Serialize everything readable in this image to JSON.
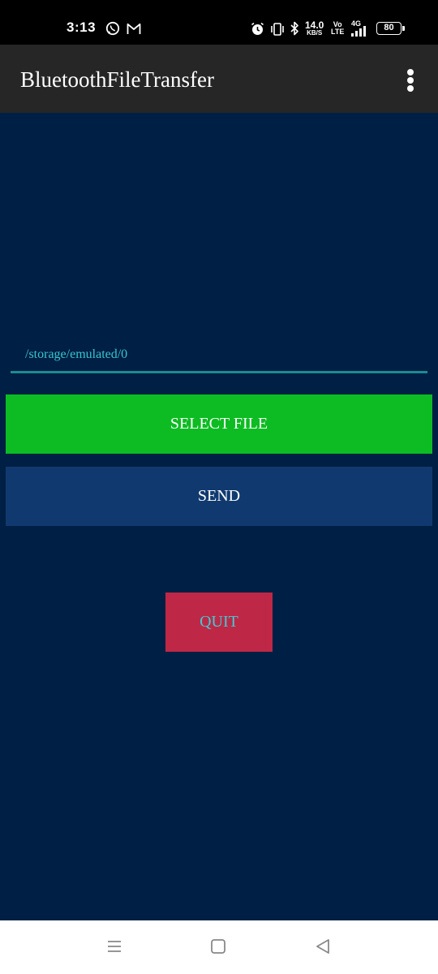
{
  "status_bar": {
    "time": "3:13",
    "notification_icons": [
      "whatsapp-icon",
      "gmail-icon"
    ],
    "system_icons": [
      "alarm-icon",
      "vibrate-icon",
      "bluetooth-icon"
    ],
    "net_speed_value": "14.0",
    "net_speed_unit": "KB/S",
    "volte_top": "Vo",
    "volte_bottom": "LTE",
    "network_type": "4G",
    "battery_level": "80"
  },
  "app_bar": {
    "title": "BluetoothFileTransfer",
    "menu_icon": "more-vert-icon"
  },
  "main": {
    "path_value": "/storage/emulated/0",
    "select_file_label": "SELECT FILE",
    "send_label": "SEND",
    "quit_label": "QUIT"
  },
  "nav_bar": {
    "icons": [
      "recents-icon",
      "home-icon",
      "back-icon"
    ]
  },
  "colors": {
    "background": "#001f44",
    "app_bar": "#262626",
    "select_button": "#0cbc22",
    "send_button": "#103a6f",
    "quit_button": "#be2846",
    "accent_teal": "#38c6cf"
  }
}
